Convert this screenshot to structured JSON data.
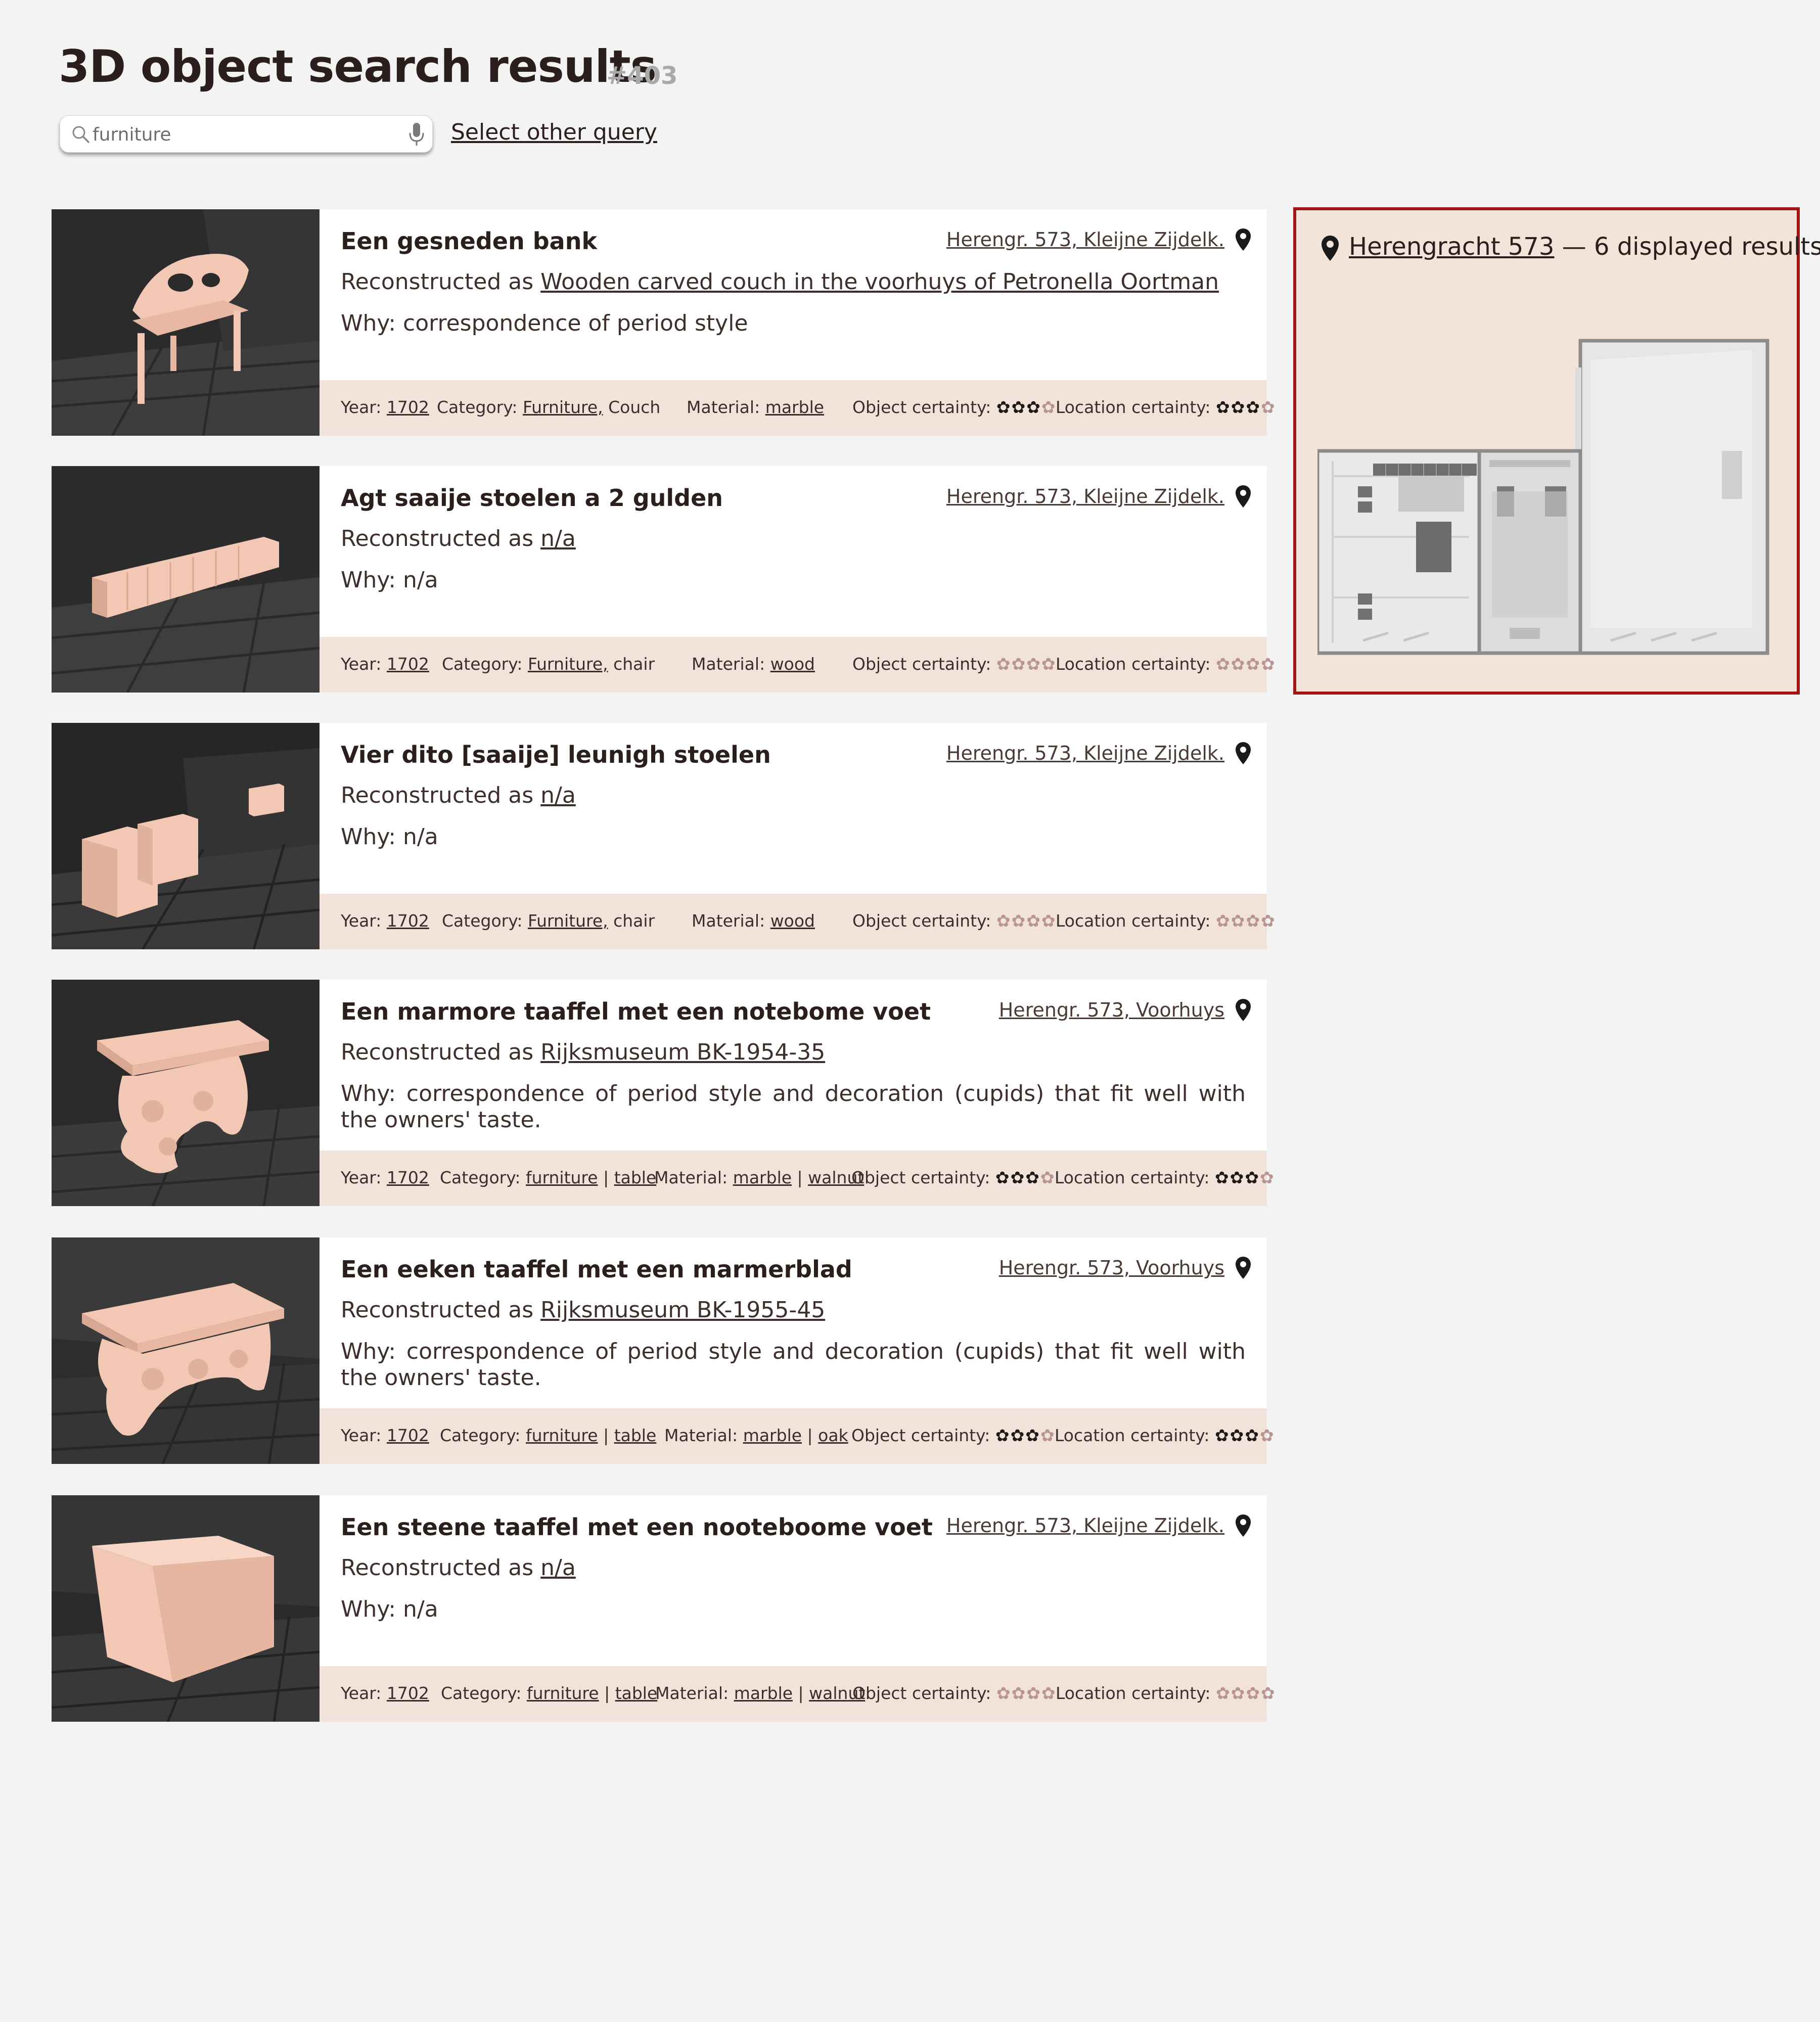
{
  "header": {
    "title": "3D object search results",
    "id": "#403"
  },
  "search": {
    "value": "furniture",
    "placeholder": "furniture",
    "other_query_label": "Select other query"
  },
  "labels": {
    "reconstructed_as": "Reconstructed as",
    "why_prefix": "Why:",
    "year": "Year:",
    "category": "Category:",
    "material": "Material:",
    "object_certainty": "Object certainty:",
    "location_certainty": "Location certainty:"
  },
  "results": [
    {
      "title": "Een gesneden bank",
      "location": "Herengr. 573, Kleijne Zijdelk.",
      "reconstructed": "Wooden carved couch in the voorhuys of Petronella Oortman",
      "why": "Why: correspondence of period style",
      "year": "1702",
      "category_link": "Furniture,",
      "category_rest": " Couch",
      "material_1": "marble",
      "material_sep": "",
      "material_2": "",
      "object_certainty": 3,
      "location_certainty": 3
    },
    {
      "title": "Agt saaije stoelen a 2 gulden",
      "location": "Herengr. 573, Kleijne Zijdelk.",
      "reconstructed": "n/a",
      "why": "Why: n/a",
      "year": "1702",
      "category_link": "Furniture,",
      "category_rest": " chair",
      "material_1": "wood",
      "material_sep": "",
      "material_2": "",
      "object_certainty": 0,
      "location_certainty": 0
    },
    {
      "title": "Vier dito [saaije] leunigh stoelen",
      "location": "Herengr. 573, Kleijne Zijdelk.",
      "reconstructed": "n/a",
      "why": "Why: n/a",
      "year": "1702",
      "category_link": "Furniture,",
      "category_rest": " chair",
      "material_1": "wood",
      "material_sep": "",
      "material_2": "",
      "object_certainty": 0,
      "location_certainty": 0
    },
    {
      "title": "Een marmore taaffel met een notebome voet",
      "location": "Herengr. 573, Voorhuys",
      "reconstructed": "Rijksmuseum BK-1954-35",
      "why": "Why: correspondence of period style and decoration (cupids) that fit well with the owners' taste.",
      "year": "1702",
      "category_link": "furniture",
      "category_sep": " | ",
      "category_link_2": "table",
      "material_1": "marble",
      "material_sep": " | ",
      "material_2": "walnut",
      "object_certainty": 3,
      "location_certainty": 3
    },
    {
      "title": "Een eeken taaffel met een marmerblad",
      "location": "Herengr. 573, Voorhuys",
      "reconstructed": "Rijksmuseum BK-1955-45",
      "why": "Why: correspondence of period style and decoration (cupids) that fit well with the owners' taste.",
      "year": "1702",
      "category_link": "furniture",
      "category_sep": " | ",
      "category_link_2": "table",
      "material_1": "marble",
      "material_sep": " | ",
      "material_2": "oak",
      "object_certainty": 3,
      "location_certainty": 3
    },
    {
      "title": "Een steene taaffel met een nooteboome voet",
      "location": "Herengr. 573, Kleijne Zijdelk.",
      "reconstructed": "n/a",
      "why": "Why: n/a",
      "year": "1702",
      "category_link": "furniture",
      "category_sep": " | ",
      "category_link_2": "table",
      "material_1": "marble",
      "material_sep": " | ",
      "material_2": "walnut",
      "object_certainty": 0,
      "location_certainty": 0
    }
  ],
  "map": {
    "location_link": "Herengracht 573",
    "summary": " — 6 displayed results"
  },
  "icons": {
    "search": "search-icon",
    "mic": "mic-icon",
    "pin": "map-pin-icon",
    "star": "flower-star-icon"
  },
  "colors": {
    "panel_border": "#a31618",
    "meta_bg": "#f2e3da",
    "object_color": "#f2c7b3"
  }
}
